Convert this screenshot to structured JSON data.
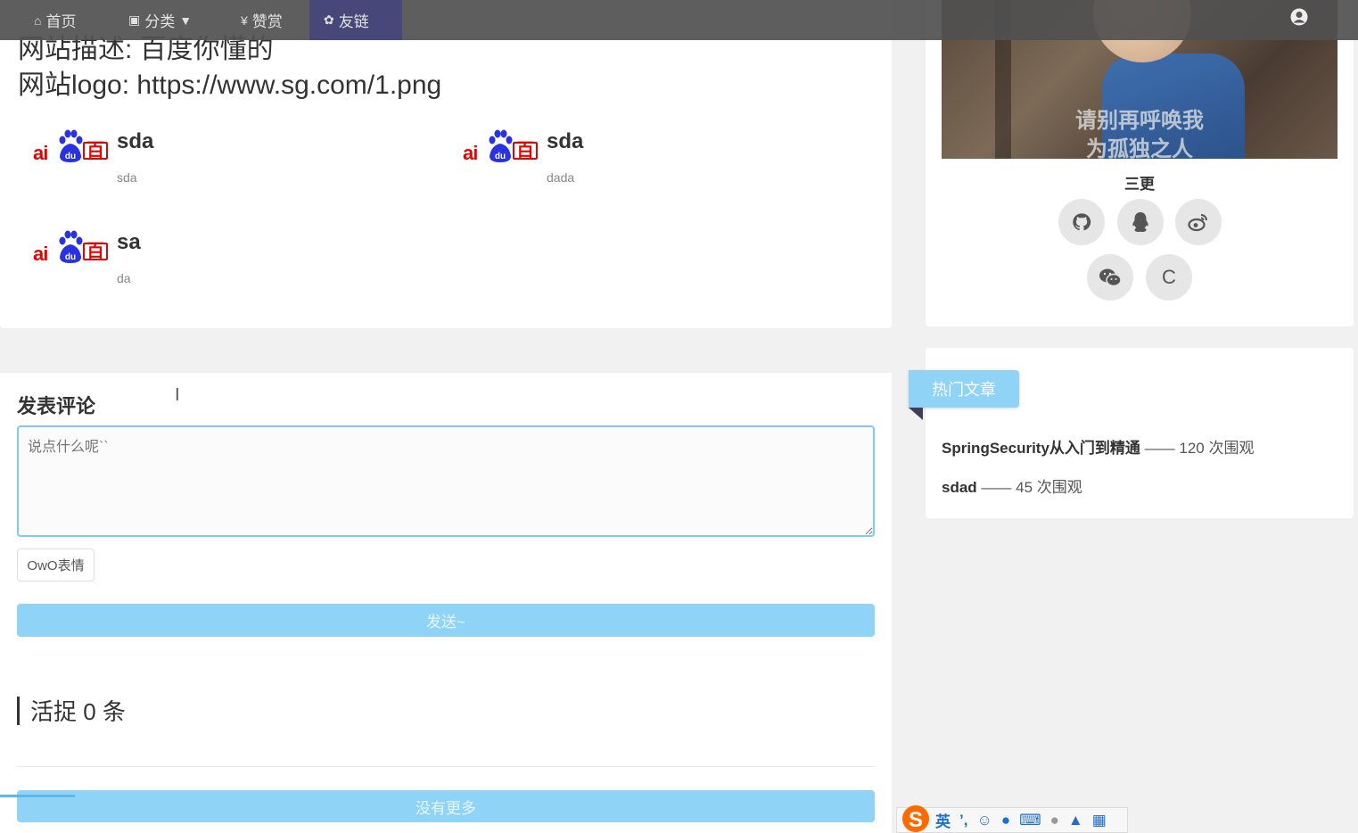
{
  "nav": {
    "items": [
      {
        "icon": "home-icon",
        "label": "首页"
      },
      {
        "icon": "category-icon",
        "label": "分类"
      },
      {
        "icon": "reward-icon",
        "label": "赞赏"
      },
      {
        "icon": "paw-icon",
        "label": "友链"
      }
    ],
    "active_index": 3
  },
  "site_info": {
    "description": "网站描述: 百度你懂的",
    "logo": "网站logo: https://www.sg.com/1.png"
  },
  "links": [
    {
      "logo_text": [
        "ai",
        "百"
      ],
      "title": "sda",
      "desc": "sda"
    },
    {
      "logo_text": [
        "ai",
        "百"
      ],
      "title": "sda",
      "desc": "dada"
    },
    {
      "logo_text": [
        "ai",
        "百"
      ],
      "title": "sa",
      "desc": "da"
    }
  ],
  "comment": {
    "title": "发表评论",
    "placeholder": "说点什么呢``",
    "owo_label": "OwO表情",
    "send_label": "发送~",
    "count_text": "活捉 0 条",
    "more_label": "没有更多"
  },
  "profile": {
    "banner_caption": [
      "请别再呼唤我",
      "为孤独之人"
    ],
    "author": "三更",
    "socials": [
      "github-icon",
      "qq-icon",
      "weibo-icon",
      "wechat-icon",
      "csdn-icon"
    ],
    "csdn_letter": "C"
  },
  "hot": {
    "title": "热门文章",
    "items": [
      {
        "title": "SpringSecurity从入门到精通",
        "views": "—— 120 次围观"
      },
      {
        "title": "sdad",
        "views": "—— 45 次围观"
      }
    ]
  },
  "ime": {
    "lang": "英",
    "icons": [
      "punct-icon",
      "emoji-icon",
      "mic-icon",
      "keyboard-icon",
      "user-icon",
      "skin-icon",
      "grid-icon"
    ]
  },
  "colors": {
    "accent": "#8fd3f7",
    "nav_active": "#47477a",
    "logo_red": "#e10602",
    "logo_blue": "#2932e1"
  }
}
